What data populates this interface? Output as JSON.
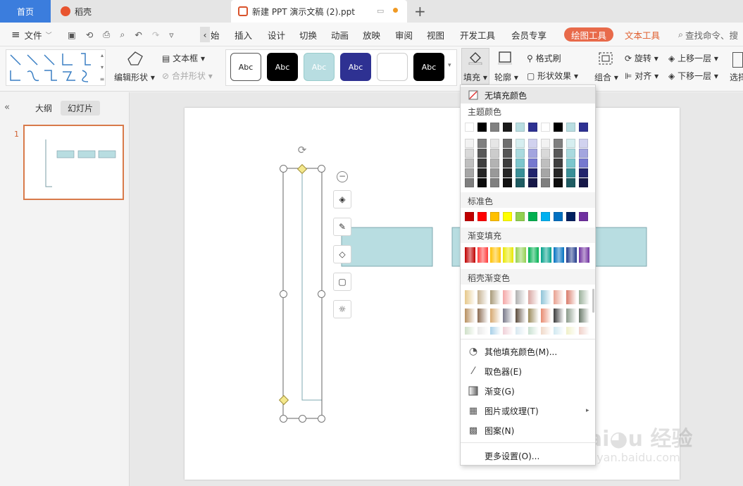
{
  "tabs": {
    "home": "首页",
    "daoke": "稻壳",
    "doc": "新建 PPT 演示文稿 (2).ppt",
    "add": "+"
  },
  "menu": {
    "file": "文件",
    "items": [
      "始",
      "插入",
      "设计",
      "切换",
      "动画",
      "放映",
      "审阅",
      "视图",
      "开发工具",
      "会员专享"
    ],
    "drawing_tools": "绘图工具",
    "text_tools": "文本工具",
    "search": "查找命令、搜"
  },
  "ribbon": {
    "edit_shape": "编辑形状",
    "textbox": "文本框",
    "merge_shape": "合并形状",
    "style_labels": [
      "Abc",
      "Abc",
      "Abc",
      "Abc",
      "",
      "Abc"
    ],
    "fill": "填充",
    "outline": "轮廓",
    "format_painter": "格式刷",
    "shape_effect": "形状效果",
    "group": "组合",
    "rotate": "旋转",
    "align": "对齐",
    "bring_forward": "上移一层",
    "send_backward": "下移一层",
    "select": "选择"
  },
  "panel": {
    "outline": "大纲",
    "slides": "幻灯片",
    "slide_no": "1"
  },
  "fill_menu": {
    "no_fill": "无填充颜色",
    "theme_colors": "主题颜色",
    "standard_colors": "标准色",
    "gradient_fill": "渐变填充",
    "daoke_gradient": "稻壳渐变色",
    "more_fill": "其他填充颜色(M)...",
    "eyedropper": "取色器(E)",
    "gradient": "渐变(G)",
    "picture_texture": "图片或纹理(T)",
    "pattern": "图案(N)",
    "more_settings": "更多设置(O)...",
    "theme_top": [
      "#ffffff",
      "#000000",
      "#808080",
      "#1a1a1a",
      "#b8dde1",
      "#2e3192",
      "#ffffff",
      "#000000",
      "#b8dde1",
      "#2e3192"
    ],
    "theme_grid": [
      [
        "#f2f2f2",
        "#7f7f7f",
        "#e6e6e6",
        "#6e6e6e",
        "#d6eef0",
        "#d1d2ef",
        "#f2f2f2",
        "#7f7f7f",
        "#d6eef0",
        "#d1d2ef"
      ],
      [
        "#d9d9d9",
        "#595959",
        "#cccccc",
        "#555555",
        "#a9dadf",
        "#a3a5df",
        "#d9d9d9",
        "#595959",
        "#a9dadf",
        "#a3a5df"
      ],
      [
        "#bfbfbf",
        "#3f3f3f",
        "#b3b3b3",
        "#3d3d3d",
        "#7cc6cd",
        "#7678cf",
        "#bfbfbf",
        "#3f3f3f",
        "#7cc6cd",
        "#7678cf"
      ],
      [
        "#a6a6a6",
        "#262626",
        "#999999",
        "#262626",
        "#3a8f97",
        "#22246d",
        "#a6a6a6",
        "#262626",
        "#3a8f97",
        "#22246d"
      ],
      [
        "#7f7f7f",
        "#0d0d0d",
        "#808080",
        "#111111",
        "#1f5c62",
        "#171848",
        "#7f7f7f",
        "#0d0d0d",
        "#1f5c62",
        "#171848"
      ]
    ],
    "standard": [
      "#c00000",
      "#ff0000",
      "#ffc000",
      "#ffff00",
      "#92d050",
      "#00b050",
      "#00b0f0",
      "#0070c0",
      "#002060",
      "#7030a0"
    ],
    "gradients": [
      "#c00000",
      "#ff3a3a",
      "#ffc000",
      "#e8e800",
      "#92d050",
      "#00b050",
      "#00a08a",
      "#0070c0",
      "#1f3a8a",
      "#7030a0"
    ],
    "daoke_rows": [
      [
        "#e6c88a",
        "#c4b08f",
        "#a89a78",
        "#f4a6a6",
        "#b0b0b0",
        "#d8a5a0",
        "#8fc4d8",
        "#e8a090",
        "#d97b6a",
        "#9ab09a"
      ],
      [
        "#b89060",
        "#8a6a50",
        "#d6a870",
        "#7a7a8a",
        "#5a4a3a",
        "#9a8a5a",
        "#e88a70",
        "#3a3a3a",
        "#8a9a8a",
        "#6a7a6a"
      ],
      [
        "#cfe0c8",
        "#e8e8e8",
        "#a8d0e8",
        "#f0d0d8",
        "#d8e8f0",
        "#c8e0d0",
        "#f0d8c8",
        "#d0e8f0",
        "#f0f0c8",
        "#f0d0c8"
      ]
    ]
  }
}
